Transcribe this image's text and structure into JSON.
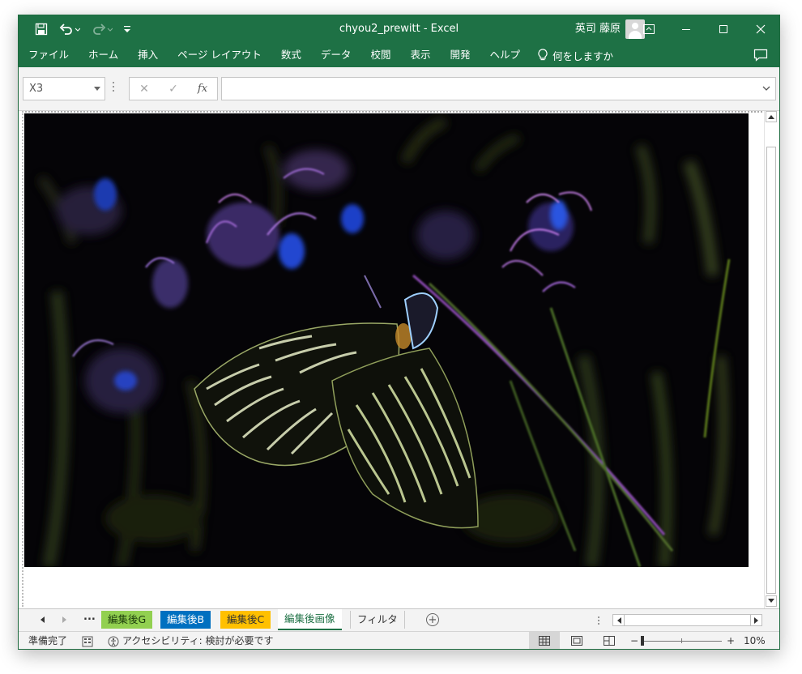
{
  "window": {
    "title": "chyou2_prewitt  -  Excel",
    "user_name": "英司 藤原"
  },
  "ribbon": {
    "tabs": [
      "ファイル",
      "ホーム",
      "挿入",
      "ページ レイアウト",
      "数式",
      "データ",
      "校閲",
      "表示",
      "開発",
      "ヘルプ"
    ],
    "tell_me": "何をしますか"
  },
  "formula_bar": {
    "name_box": "X3",
    "cancel": "✕",
    "enter": "✓",
    "fx": "fx",
    "formula": ""
  },
  "sheet_tabs": {
    "more": "...",
    "tabs": [
      {
        "label": "編集後G",
        "color": "#92d050"
      },
      {
        "label": "編集後B",
        "color": "#0070c0"
      },
      {
        "label": "編集後C",
        "color": "#ffc000"
      },
      {
        "label": "編集後画像",
        "active": true
      },
      {
        "label": "フィルタ"
      }
    ]
  },
  "status_bar": {
    "ready": "準備完了",
    "accessibility": "アクセシビリティ: 検討が必要です",
    "zoom_minus": "−",
    "zoom_plus": "+",
    "zoom_level": "10%"
  },
  "image": {
    "description_icon": "butterfly-edge-filtered-image"
  }
}
